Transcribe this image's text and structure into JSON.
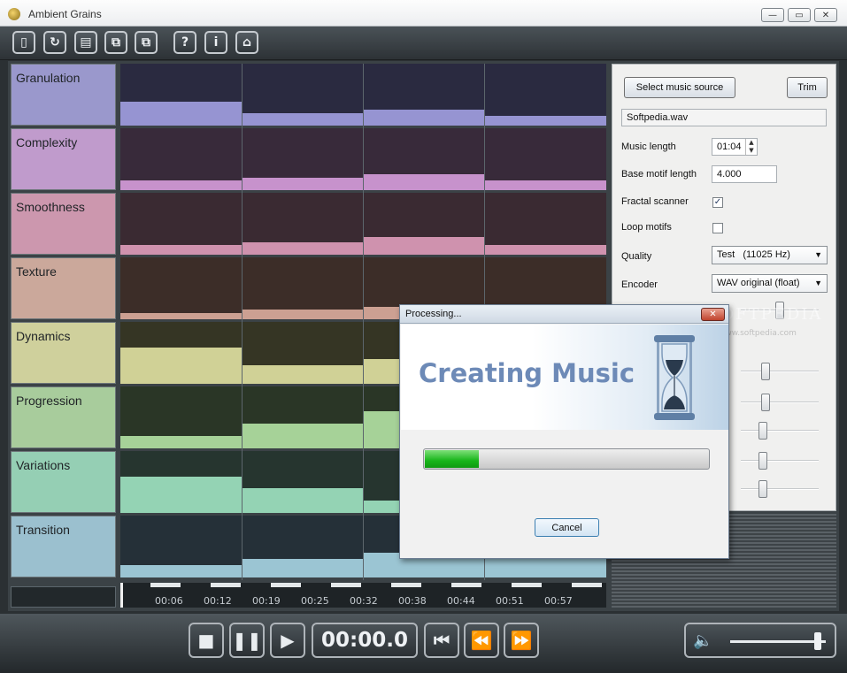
{
  "window": {
    "title": "Ambient Grains"
  },
  "toolbar": {
    "buttons": [
      "new-icon",
      "open-icon",
      "table-icon",
      "copy-icon",
      "paste-icon",
      "help-icon",
      "info-icon",
      "home-icon"
    ]
  },
  "rows": [
    {
      "label": "Granulation",
      "label_color": "#9a98cc",
      "bg": "#2a2a40",
      "fill": "#9694d2",
      "levels": [
        0.38,
        0.2,
        0.26,
        0.16
      ]
    },
    {
      "label": "Complexity",
      "label_color": "#c09bcc",
      "bg": "#382a3a",
      "fill": "#c792cc",
      "levels": [
        0.16,
        0.2,
        0.26,
        0.16
      ]
    },
    {
      "label": "Smoothness",
      "label_color": "#cc97ae",
      "bg": "#3a2a32",
      "fill": "#cf92ae",
      "levels": [
        0.16,
        0.2,
        0.28,
        0.16
      ]
    },
    {
      "label": "Texture",
      "label_color": "#cba89b",
      "bg": "#3c2d28",
      "fill": "#cca092",
      "levels": [
        0.1,
        0.16,
        0.2,
        0.1
      ]
    },
    {
      "label": "Dynamics",
      "label_color": "#cfd09c",
      "bg": "#353524",
      "fill": "#d0d196",
      "levels": [
        0.58,
        0.3,
        0.4,
        0.3
      ]
    },
    {
      "label": "Progression",
      "label_color": "#a8cc9c",
      "bg": "#2a3626",
      "fill": "#a6d298",
      "levels": [
        0.2,
        0.4,
        0.6,
        0.3
      ]
    },
    {
      "label": "Variations",
      "label_color": "#95cfb4",
      "bg": "#26352f",
      "fill": "#94d3b4",
      "levels": [
        0.58,
        0.4,
        0.2,
        0.3
      ]
    },
    {
      "label": "Transition",
      "label_color": "#9bc0cf",
      "bg": "#253038",
      "fill": "#9bc5d3",
      "levels": [
        0.2,
        0.3,
        0.4,
        0.3
      ]
    }
  ],
  "timeline": {
    "ticks": [
      "00:06",
      "00:12",
      "00:19",
      "00:25",
      "00:32",
      "00:38",
      "00:44",
      "00:51",
      "00:57"
    ]
  },
  "panel": {
    "select_source_label": "Select music source",
    "trim_label": "Trim",
    "source_file": "Softpedia.wav",
    "music_length_label": "Music length",
    "music_length_value": "01:04",
    "base_motif_label": "Base motif length",
    "base_motif_value": "4.000",
    "fractal_label": "Fractal scanner",
    "fractal_checked": true,
    "loop_label": "Loop motifs",
    "loop_checked": false,
    "quality_label": "Quality",
    "quality_value": "Test   (11025 Hz)",
    "encoder_label": "Encoder",
    "encoder_value": "WAV original (float)",
    "slider_levels": [
      0.5,
      0.3,
      0.3,
      0.25,
      0.25,
      0.25
    ]
  },
  "watermark": {
    "text": "SOFTPEDIA",
    "sub": "www.softpedia.com"
  },
  "dialog": {
    "title": "Processing...",
    "heading": "Creating Music",
    "progress": 0.19,
    "cancel_label": "Cancel"
  },
  "transport": {
    "time": "00:00.0",
    "volume": 0.95
  }
}
